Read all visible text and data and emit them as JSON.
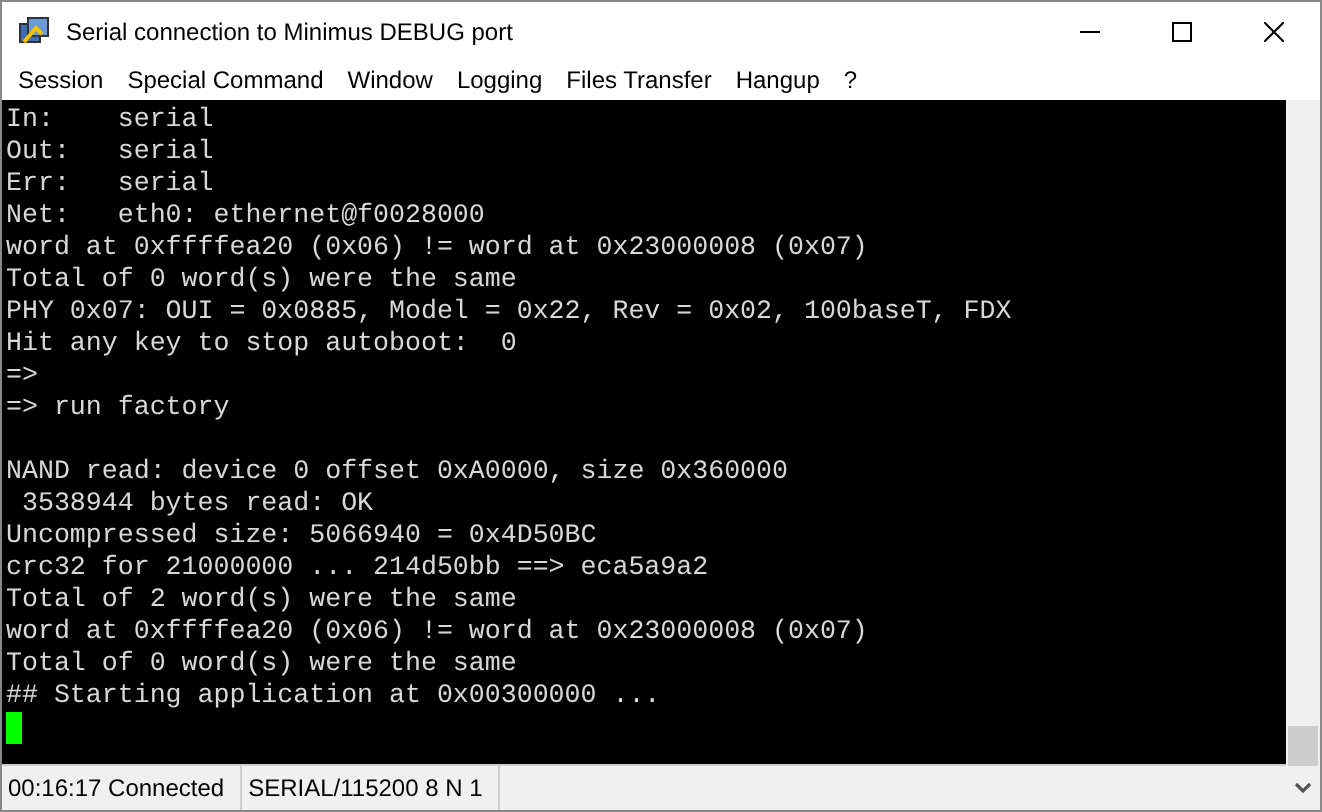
{
  "window": {
    "title": "Serial connection to Minimus DEBUG port"
  },
  "menu": [
    "Session",
    "Special Command",
    "Window",
    "Logging",
    "Files Transfer",
    "Hangup",
    "?"
  ],
  "terminal": {
    "blocks": [
      [
        "In:    serial",
        "Out:   serial",
        "Err:   serial",
        "Net:   eth0: ethernet@f0028000",
        "word at 0xffffea20 (0x06) != word at 0x23000008 (0x07)",
        "Total of 0 word(s) were the same",
        "PHY 0x07: OUI = 0x0885, Model = 0x22, Rev = 0x02, 100baseT, FDX",
        "Hit any key to stop autoboot:  0",
        "=>",
        "=> run factory"
      ],
      [
        "NAND read: device 0 offset 0xA0000, size 0x360000",
        " 3538944 bytes read: OK",
        "Uncompressed size: 5066940 = 0x4D50BC",
        "crc32 for 21000000 ... 214d50bb ==> eca5a9a2",
        "Total of 2 word(s) were the same",
        "word at 0xffffea20 (0x06) != word at 0x23000008 (0x07)",
        "Total of 0 word(s) were the same",
        "## Starting application at 0x00300000 ..."
      ]
    ],
    "cursor": true
  },
  "status_bar": [
    "00:16:17 Connected",
    "SERIAL/115200 8 N 1"
  ]
}
